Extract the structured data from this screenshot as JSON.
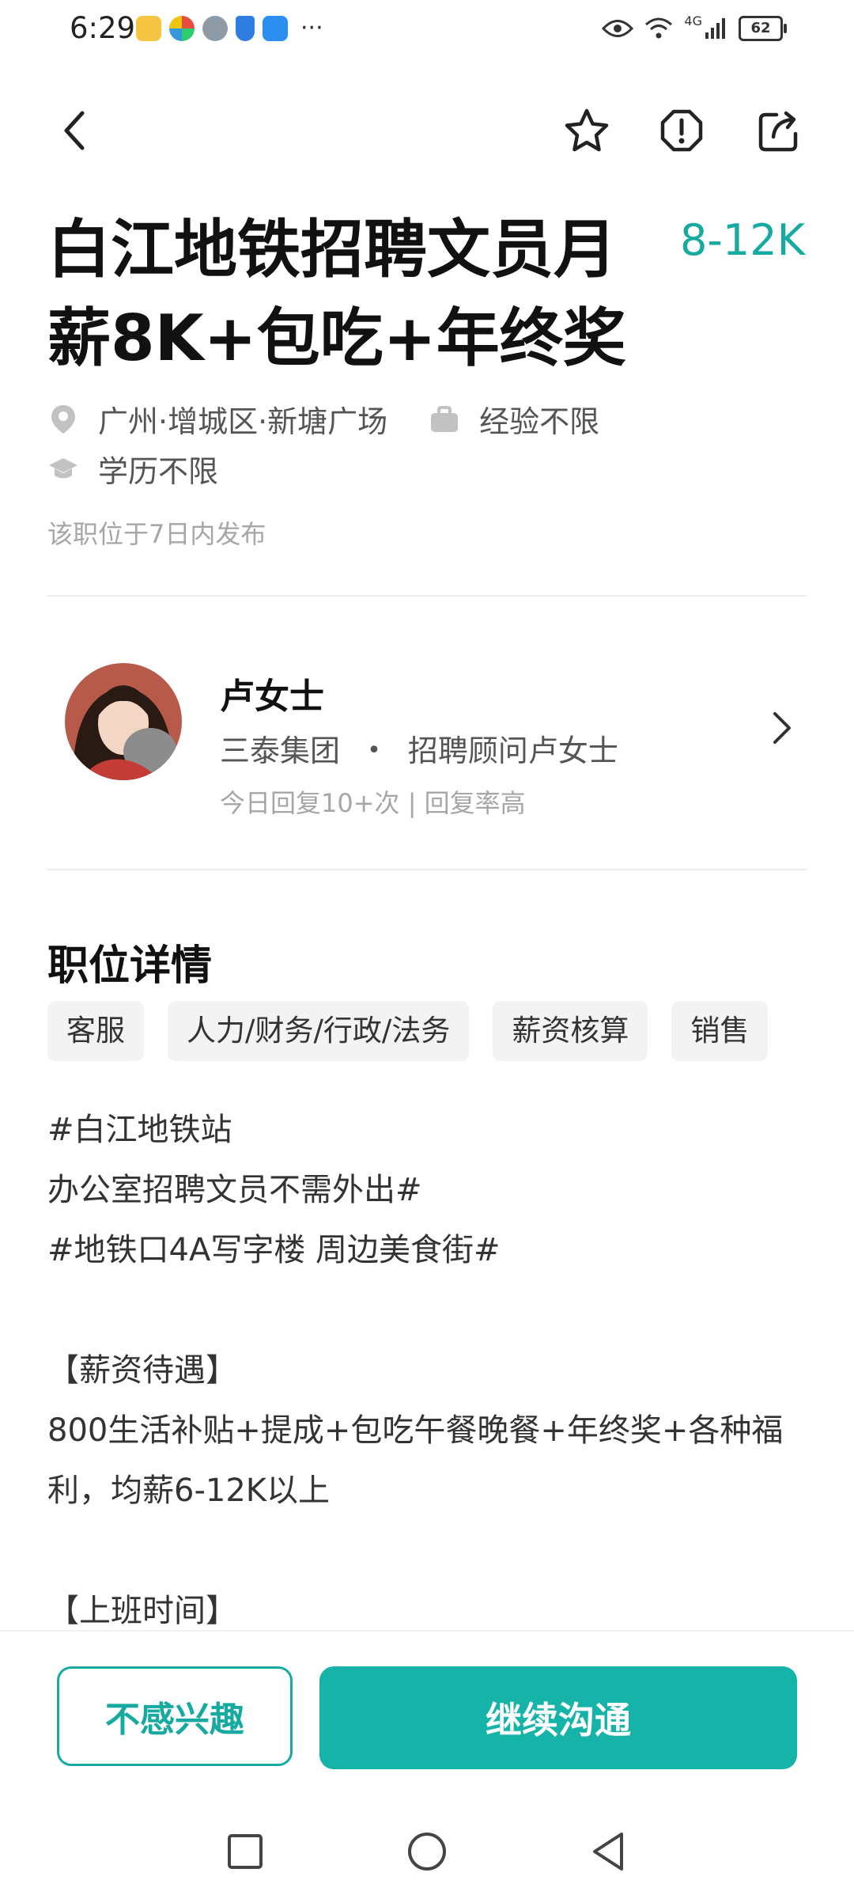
{
  "status_bar": {
    "time": "6:29",
    "battery": "62",
    "network": "4G",
    "more": "···"
  },
  "job": {
    "title": "白江地铁招聘文员月薪8K+包吃+年终奖",
    "salary": "8-12K",
    "location": "广州·增城区·新塘广场",
    "experience": "经验不限",
    "education": "学历不限",
    "posted": "该职位于7日内发布"
  },
  "recruiter": {
    "name": "卢女士",
    "company": "三泰集团",
    "separator": "•",
    "role": "招聘顾问卢女士",
    "stat": "今日回复10+次 | 回复率高"
  },
  "details": {
    "title": "职位详情",
    "tags": [
      "客服",
      "人力/财务/行政/法务",
      "薪资核算",
      "销售"
    ],
    "description": "#白江地铁站\n办公室招聘文员不需外出#\n#地铁口4A写字楼 周边美食街#\n\n【薪资待遇】\n800生活补贴+提成+包吃午餐晚餐+年终奖+各种福利，均薪6-12K以上\n\n【上班时间】"
  },
  "actions": {
    "not_interested": "不感兴趣",
    "continue_chat": "继续沟通"
  },
  "colors": {
    "accent": "#16aaa0",
    "button": "#16b3a8"
  },
  "icons": [
    "back-icon",
    "star-icon",
    "report-icon",
    "share-icon",
    "location-icon",
    "briefcase-icon",
    "graduation-icon",
    "chevron-right-icon"
  ]
}
